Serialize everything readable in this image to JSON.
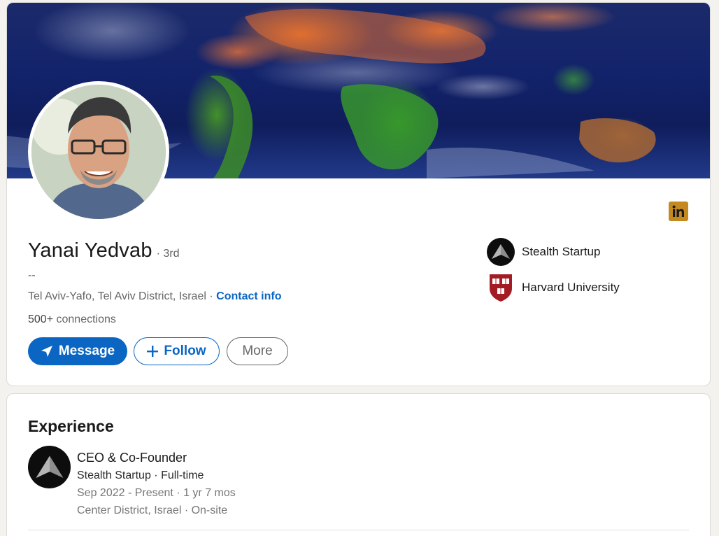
{
  "profile": {
    "name": "Yanai Yedvab",
    "degree": "· 3rd",
    "headline": "--",
    "location": "Tel Aviv-Yafo, Tel Aviv District, Israel ·",
    "contact_info": "Contact info",
    "connections_count": "500+",
    "connections_label": "connections",
    "linkedin_badge": "in"
  },
  "actions": {
    "message": "Message",
    "follow": "Follow",
    "more": "More"
  },
  "organizations": [
    {
      "name": "Stealth Startup",
      "icon": "stealth-startup-logo"
    },
    {
      "name": "Harvard University",
      "icon": "harvard-shield-logo"
    }
  ],
  "experience": {
    "title": "Experience",
    "items": [
      {
        "role": "CEO & Co-Founder",
        "company": "Stealth Startup · Full-time",
        "dates": "Sep 2022 - Present · 1 yr 7 mos",
        "location": "Center District, Israel · On-site"
      }
    ]
  },
  "colors": {
    "primary": "#0a66c2",
    "linkedin_badge": "#c48a20",
    "page_bg": "#f4f2ee"
  }
}
